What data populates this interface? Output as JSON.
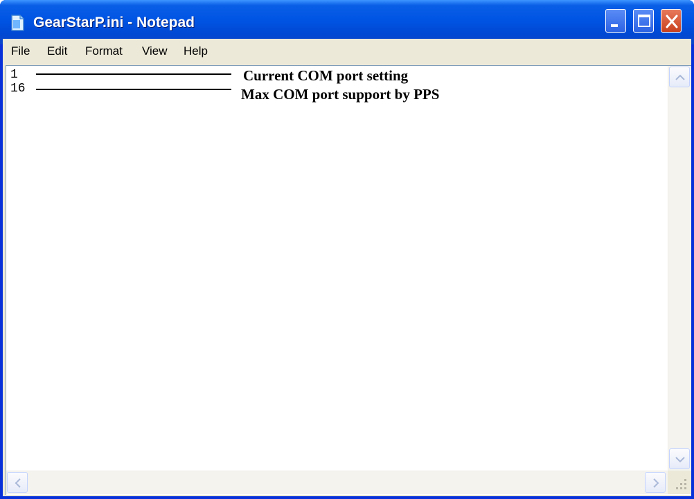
{
  "window": {
    "title": "GearStarP.ini - Notepad",
    "icon": "notepad-icon"
  },
  "menu": [
    "File",
    "Edit",
    "Format",
    "View",
    "Help"
  ],
  "document": {
    "lines": [
      "1",
      "16"
    ]
  },
  "annotations": [
    "Current COM port setting",
    "Max COM port support by PPS"
  ],
  "colors": {
    "titlebar": "#0054e3",
    "close_button": "#c9411e",
    "frame": "#ece9d8"
  }
}
